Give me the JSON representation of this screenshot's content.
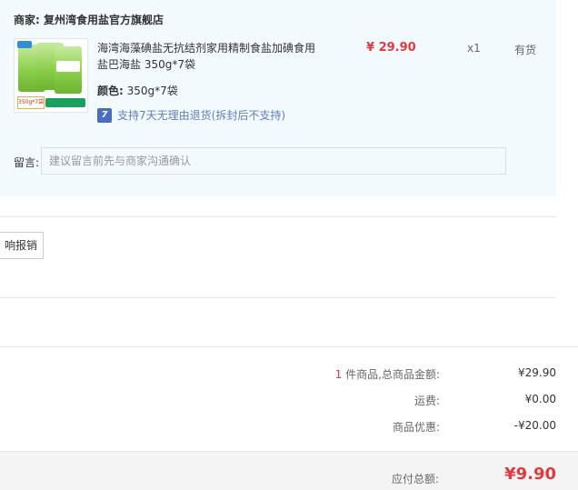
{
  "merchant": {
    "label": "商家:",
    "name": "复州湾食用盐官方旗舰店"
  },
  "product": {
    "thumb_sticker": "350g*7袋",
    "title": "海湾海藻碘盐无抗结剂家用精制食盐加碘食用盐巴海盐 350g*7袋",
    "attr_label": "颜色:",
    "attr_value": "350g*7袋",
    "return_icon": "7",
    "return_policy": "支持7天无理由退货(拆封后不支持)",
    "price": "¥ 29.90",
    "quantity": "x1",
    "stock": "有货"
  },
  "message": {
    "label": "留言:",
    "placeholder": "建议留言前先与商家沟通确认"
  },
  "invoice": {
    "button_label": "响报销"
  },
  "summary": {
    "item_count": "1",
    "items_label": "件商品,总商品金额:",
    "items_amount": "¥29.90",
    "shipping_label": "运费:",
    "shipping_amount": "¥0.00",
    "discount_label": "商品优惠:",
    "discount_amount": "-¥20.00",
    "total_label": "应付总额:",
    "total_amount": "¥9.90"
  },
  "colors": {
    "price_red": "#e4393c",
    "order_bg": "#f3fafe",
    "policy_blue": "#5f7fc2"
  },
  "icons": {
    "return": "seven-day-return-icon",
    "thumbnail": "salt-package-image"
  }
}
